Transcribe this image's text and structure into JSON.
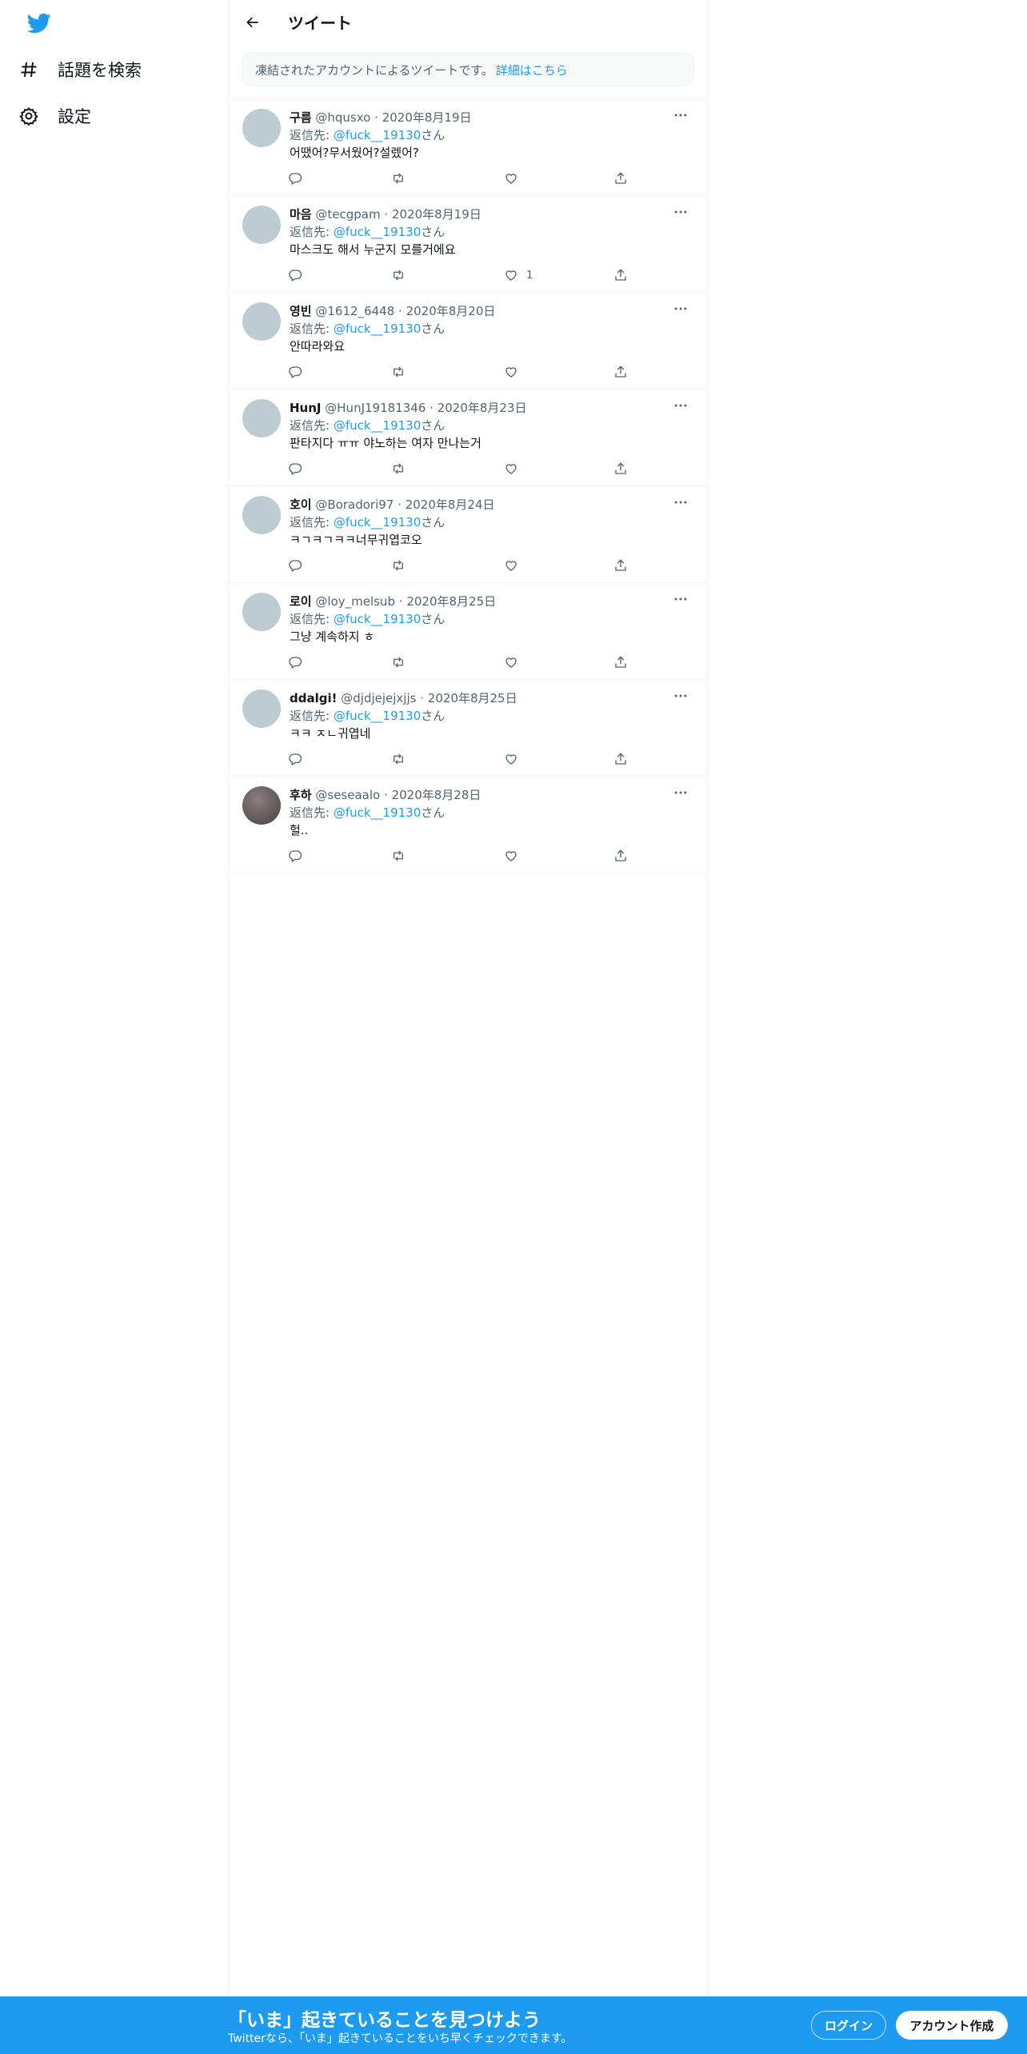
{
  "sidebar": {
    "logo_icon": "twitter-bird-icon",
    "items": [
      {
        "label": "話題を検索",
        "icon": "hashtag-icon"
      },
      {
        "label": "設定",
        "icon": "gear-icon"
      }
    ]
  },
  "header": {
    "title": "ツイート",
    "back_icon": "arrow-left-icon"
  },
  "notice": {
    "text": "凍結されたアカウントによるツイートです。",
    "link": "詳細はこちら"
  },
  "reply_label": "返信先: ",
  "reply_suffix": "さん",
  "tweets": [
    {
      "name": "구름",
      "handle": "@hqusxo",
      "dot": "·",
      "date": "2020年8月19日",
      "mention": "@fuck__19130",
      "text": "어땠어?무서웠어?설렜어?",
      "likes": ""
    },
    {
      "name": "마음",
      "handle": "@tecgpam",
      "dot": "·",
      "date": "2020年8月19日",
      "mention": "@fuck__19130",
      "text": "마스크도 해서 누군지 모를거에요",
      "likes": "1"
    },
    {
      "name": "영빈",
      "handle": "@1612_6448",
      "dot": "·",
      "date": "2020年8月20日",
      "mention": "@fuck__19130",
      "text": "안따라와요",
      "likes": ""
    },
    {
      "name": "HunJ",
      "handle": "@HunJ19181346",
      "dot": "·",
      "date": "2020年8月23日",
      "mention": "@fuck__19130",
      "text": "판타지다 ㅠㅠ 야노하는 여자 만나는거",
      "likes": ""
    },
    {
      "name": "호이",
      "handle": "@Boradori97",
      "dot": "·",
      "date": "2020年8月24日",
      "mention": "@fuck__19130",
      "text": "ㅋㄱㅋㄱㅋㅋ너무귀엽코오",
      "likes": ""
    },
    {
      "name": "로이",
      "handle": "@loy_melsub",
      "dot": "·",
      "date": "2020年8月25日",
      "mention": "@fuck__19130",
      "text": "그냥 계속하지 ㅎ",
      "likes": ""
    },
    {
      "name": "ddalgi!",
      "handle": "@djdjejejxjjs",
      "dot": "·",
      "date": "2020年8月25日",
      "mention": "@fuck__19130",
      "text": "ㅋㅋ ㅈㄴ귀엽네",
      "likes": ""
    },
    {
      "name": "후하",
      "handle": "@seseaalo",
      "dot": "·",
      "date": "2020年8月28日",
      "mention": "@fuck__19130",
      "text": "헐..",
      "likes": ""
    }
  ],
  "bottom_bar": {
    "title": "「いま」起きていることを見つけよう",
    "subtitle": "Twitterなら、「いま」起きていることをいち早くチェックできます。",
    "login": "ログイン",
    "signup": "アカウント作成"
  },
  "colors": {
    "accent": "#1d9bf0",
    "text": "#0f1419",
    "secondary": "#536471",
    "border": "#eff3f4"
  }
}
